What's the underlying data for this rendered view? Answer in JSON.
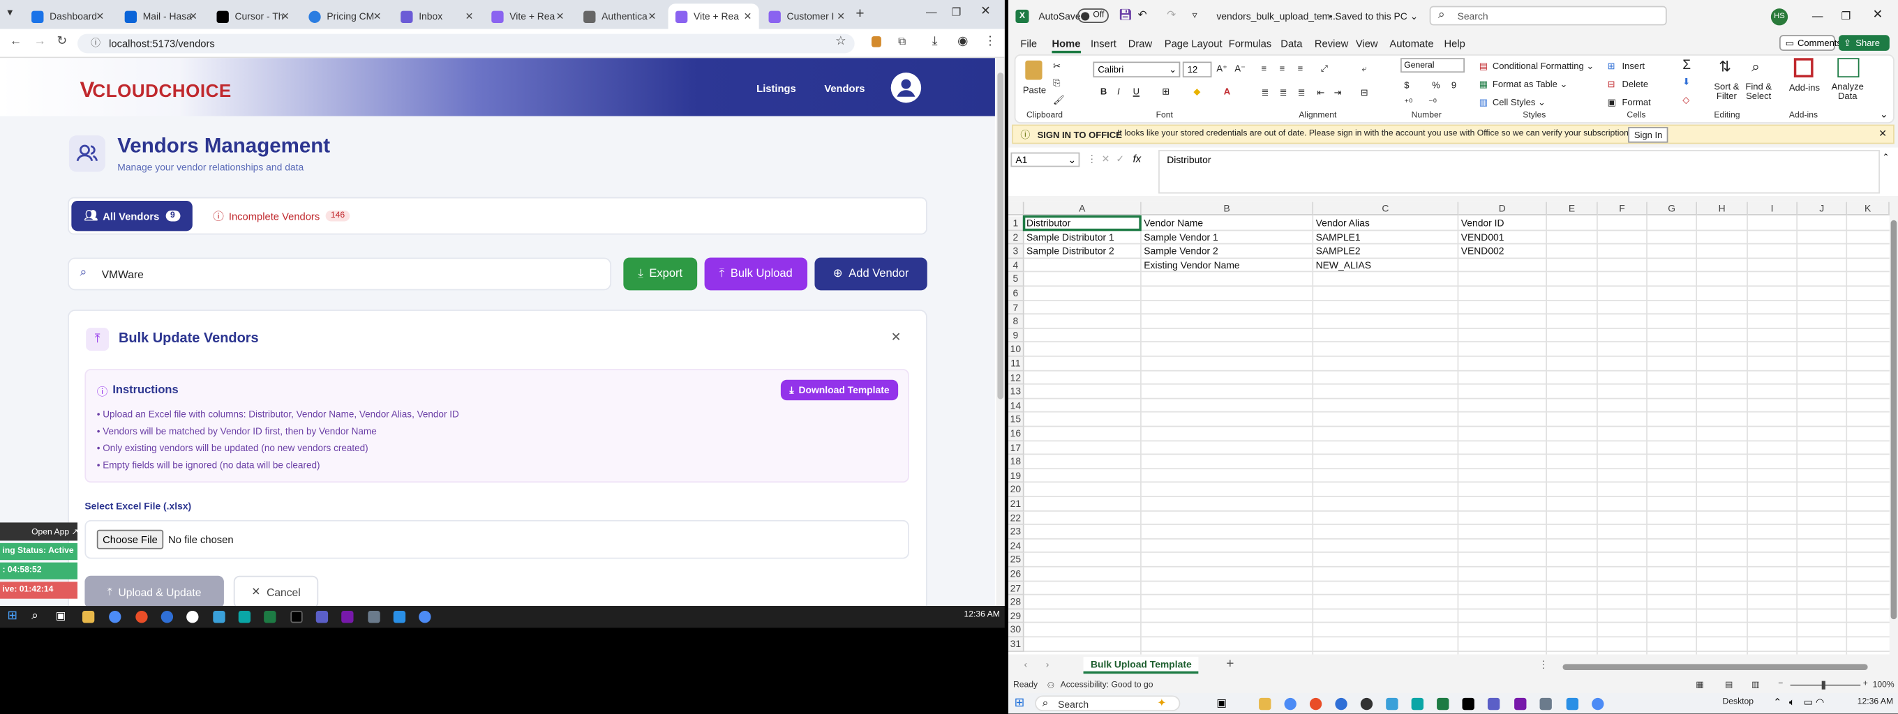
{
  "chrome": {
    "tabs": [
      {
        "label": "Dashboard",
        "color": "#1a73e8"
      },
      {
        "label": "Mail - Hasa",
        "color": "#0a64d8"
      },
      {
        "label": "Cursor - Th",
        "color": "#000000"
      },
      {
        "label": "Pricing CM",
        "color": "#2a7de1"
      },
      {
        "label": "Inbox",
        "color": "#6b5bd6"
      },
      {
        "label": "Vite + Rea",
        "color": "#8a63f0"
      },
      {
        "label": "Authentica",
        "color": "#666666"
      },
      {
        "label": "Vite + Rea",
        "color": "#8a63f0"
      },
      {
        "label": "Customer I",
        "color": "#8a63f0"
      }
    ],
    "url": "localhost:5173/vendors"
  },
  "app": {
    "logo": "CLOUDCHOICE",
    "logo_v": "V",
    "nav": {
      "listings": "Listings",
      "vendors": "Vendors"
    },
    "title": "Vendors Management",
    "subtitle": "Manage your vendor relationships and data",
    "tabs": {
      "all_label": "All Vendors",
      "all_count": "9",
      "incomplete_label": "Incomplete Vendors",
      "incomplete_count": "146"
    },
    "search_value": "VMWare",
    "buttons": {
      "export": "Export",
      "bulk_upload": "Bulk Upload",
      "add_vendor": "Add Vendor"
    },
    "bulk": {
      "title": "Bulk Update Vendors",
      "instructions_title": "Instructions",
      "download_template": "Download Template",
      "instructions": [
        "• Upload an Excel file with columns: Distributor, Vendor Name, Vendor Alias, Vendor ID",
        "• Vendors will be matched by Vendor ID first, then by Vendor Name",
        "• Only existing vendors will be updated (no new vendors created)",
        "• Empty fields will be ignored (no data will be cleared)"
      ],
      "file_label": "Select Excel File (.xlsx)",
      "choose_file": "Choose File",
      "no_file": "No file chosen",
      "upload": "Upload & Update",
      "cancel": "Cancel"
    }
  },
  "sidepanel": {
    "open_app": "Open App ↗",
    "status": "ing Status: Active",
    "timer1": ": 04:58:52",
    "timer2": "ive: 01:42:14"
  },
  "taskbar_left": {
    "time": "12:36 AM"
  },
  "excel": {
    "autosave": "AutoSave",
    "autosave_state": "Off",
    "filename": "vendors_bulk_upload_tem...",
    "saved": "• Saved to this PC ⌄",
    "search_placeholder": "Search",
    "user_initials": "HS",
    "menu": [
      "File",
      "Home",
      "Insert",
      "Draw",
      "Page Layout",
      "Formulas",
      "Data",
      "Review",
      "View",
      "Automate",
      "Help"
    ],
    "comments": "Comments",
    "share": "Share",
    "ribbon": {
      "paste": "Paste",
      "font_name": "Calibri",
      "font_size": "12",
      "number_format": "General",
      "conditional_formatting": "Conditional Formatting ⌄",
      "format_as_table": "Format as Table ⌄",
      "cell_styles": "Cell Styles ⌄",
      "insert": "Insert",
      "delete": "Delete",
      "format": "Format",
      "sort_filter": "Sort &\nFilter",
      "find_select": "Find &\nSelect",
      "addins": "Add-ins",
      "analyze": "Analyze\nData",
      "groups": [
        "Clipboard",
        "Font",
        "Alignment",
        "Number",
        "Styles",
        "Cells",
        "Editing",
        "Add-ins"
      ]
    },
    "signin_bar": {
      "title": "SIGN IN TO OFFICE",
      "message": "It looks like your stored credentials are out of date. Please sign in with the account you use with Office so we can verify your subscription.",
      "button": "Sign In"
    },
    "name_box": "A1",
    "formula": "Distributor",
    "columns": [
      "A",
      "B",
      "C",
      "D",
      "E",
      "F",
      "G",
      "H",
      "I",
      "J",
      "K"
    ],
    "rows": [
      "1",
      "2",
      "3",
      "4",
      "5",
      "6",
      "7",
      "8",
      "9",
      "10",
      "11",
      "12",
      "13",
      "14",
      "15",
      "16",
      "17",
      "18",
      "19",
      "20",
      "21",
      "22",
      "23",
      "24",
      "25",
      "26",
      "27",
      "28",
      "29",
      "30",
      "31"
    ],
    "cells": [
      [
        "Distributor",
        "Vendor Name",
        "Vendor Alias",
        "Vendor ID"
      ],
      [
        "Sample Distributor 1",
        "Sample Vendor 1",
        "SAMPLE1",
        "VEND001"
      ],
      [
        "Sample Distributor 2",
        "Sample Vendor 2",
        "SAMPLE2",
        "VEND002"
      ],
      [
        "",
        "Existing Vendor Name",
        "NEW_ALIAS",
        ""
      ]
    ],
    "sheet_tab": "Bulk Upload Template",
    "status_ready": "Ready",
    "accessibility": "Accessibility: Good to go",
    "zoom": "100%",
    "display_settings": "Desktop"
  },
  "taskbar_right": {
    "search": "Search",
    "time": "12:36 AM"
  }
}
